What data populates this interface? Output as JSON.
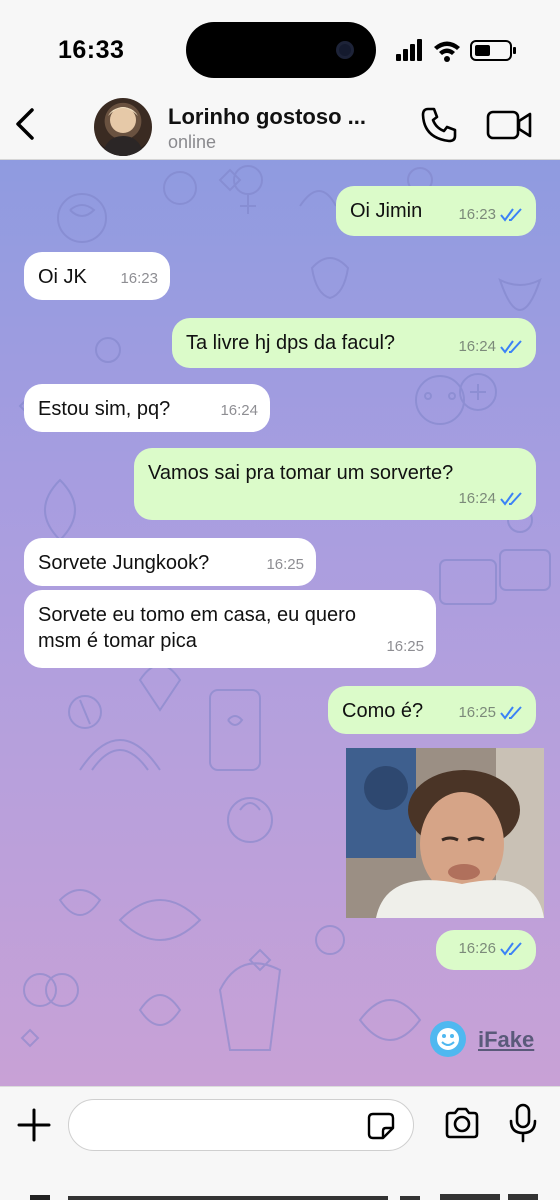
{
  "status_bar": {
    "time": "16:33"
  },
  "header": {
    "contact_name": "Lorinho gostoso ...",
    "status": "online"
  },
  "messages": [
    {
      "direction": "out",
      "text": "Oi Jimin",
      "time": "16:23"
    },
    {
      "direction": "in",
      "text": "Oi JK",
      "time": "16:23"
    },
    {
      "direction": "out",
      "text": "Ta livre hj dps da facul?",
      "time": "16:24"
    },
    {
      "direction": "in",
      "text": "Estou sim, pq?",
      "time": "16:24"
    },
    {
      "direction": "out",
      "text": "Vamos sai pra tomar um sorverte?",
      "time": "16:24"
    },
    {
      "direction": "in",
      "text": "Sorvete Jungkook?",
      "time": "16:25"
    },
    {
      "direction": "in",
      "text_line1": "Sorvete eu tomo em casa, eu quero",
      "text_line2": "msm é tomar pica",
      "time": "16:25"
    },
    {
      "direction": "out",
      "text": "Como é?",
      "time": "16:25"
    },
    {
      "direction": "out",
      "type": "photo",
      "time": "16:26"
    }
  ],
  "watermark": {
    "label": "iFake"
  },
  "colors": {
    "outgoing_bubble": "#dbfbc9",
    "incoming_bubble": "#ffffff",
    "read_ticks": "#3b82f6",
    "accent": "#4fb8f0"
  }
}
